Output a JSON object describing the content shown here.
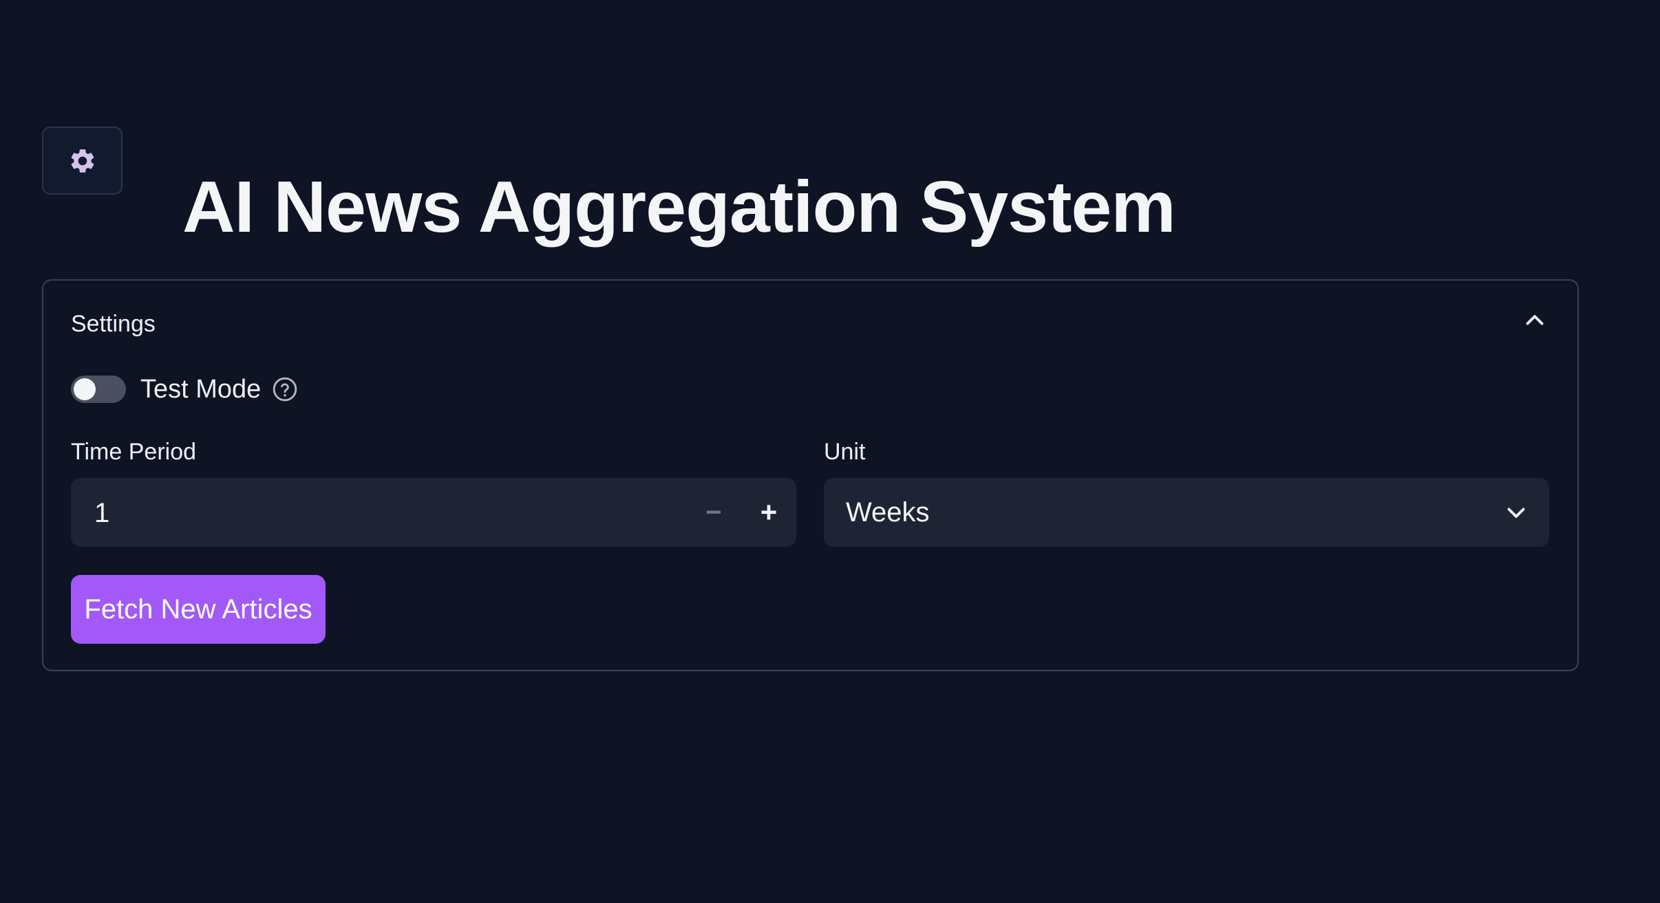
{
  "app": {
    "title": "AI News Aggregation System"
  },
  "toolbar": {
    "settings_icon": "gear-icon"
  },
  "settings_panel": {
    "title": "Settings",
    "collapse_icon": "chevron-up-icon",
    "test_mode": {
      "label": "Test Mode",
      "enabled": false,
      "help_icon": "help-icon"
    },
    "time_period": {
      "label": "Time Period",
      "value": "1",
      "decrement_label": "−",
      "increment_label": "+"
    },
    "unit": {
      "label": "Unit",
      "selected": "Weeks",
      "dropdown_icon": "chevron-down-icon"
    },
    "fetch_button": {
      "label": "Fetch New Articles"
    }
  },
  "colors": {
    "background": "#0e1424",
    "accent": "#a259f7",
    "input_bg": "#1e2434",
    "border": "#3a4152",
    "icon_tint": "#c9b6e8"
  }
}
